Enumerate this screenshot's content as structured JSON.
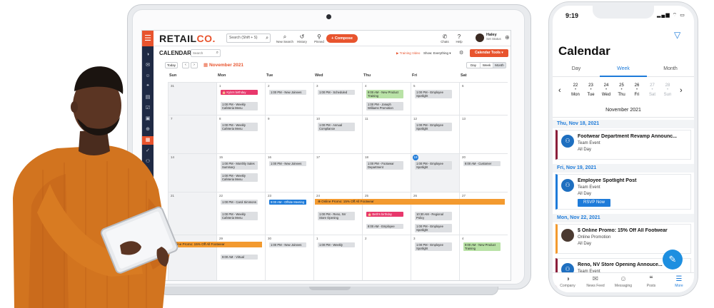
{
  "app": {
    "logo_main": "RETAIL",
    "logo_accent": "CO.",
    "search_placeholder": "Search (Shift + S)",
    "toolbar": [
      {
        "id": "new-search",
        "label": "New Search",
        "icon": "new-search-icon",
        "glyph": "⌕"
      },
      {
        "id": "history",
        "label": "History",
        "icon": "history-icon",
        "glyph": "↺"
      },
      {
        "id": "pinned",
        "label": "Pinned",
        "icon": "pin-icon",
        "glyph": "⚲"
      }
    ],
    "compose_label": "+ Compose",
    "chats_label": "Chats",
    "help_label": "Help",
    "user_name": "Haley",
    "user_status": "Set Status"
  },
  "sidebar_icons": [
    "company-icon",
    "news-feed-icon",
    "messaging-icon",
    "posts-icon",
    "folder-icon",
    "tasks-icon",
    "gallery-icon",
    "globe-icon",
    "calendar-icon",
    "check-icon",
    "people-icon",
    "edit-icon",
    "gift-icon",
    "settings-icon"
  ],
  "calendar": {
    "title": "CALENDAR",
    "search_placeholder": "Search",
    "training_label": "Training Video",
    "show_label": "Show: Everything ▾",
    "tools_label": "Calendar Tools ▾",
    "today_label": "Today",
    "prev": "‹",
    "next": "›",
    "month_label": "November 2021",
    "views": [
      "Day",
      "Week",
      "Month"
    ],
    "active_view": "Month",
    "days_of_week": [
      "Sun",
      "Mon",
      "Tue",
      "Wed",
      "Thu",
      "Fri",
      "Sat"
    ],
    "weeks": [
      [
        "31",
        "1",
        "2",
        "3",
        "4",
        "5",
        "6"
      ],
      [
        "7",
        "8",
        "9",
        "10",
        "11",
        "12",
        "13"
      ],
      [
        "14",
        "15",
        "16",
        "17",
        "18",
        "19",
        "20"
      ],
      [
        "21",
        "22",
        "23",
        "24",
        "25",
        "26",
        "27"
      ],
      [
        "28",
        "29",
        "30",
        "1",
        "2",
        "3",
        "4"
      ]
    ],
    "today_date": "19",
    "events": [
      {
        "week": 0,
        "day": 1,
        "slot": 0,
        "style": "pink",
        "text": "🎂 Kyla's birthday"
      },
      {
        "week": 0,
        "day": 1,
        "slot": 1,
        "style": "gray",
        "text": "1:00 PM - Weekly Cafeteria Menu"
      },
      {
        "week": 0,
        "day": 2,
        "slot": 0,
        "style": "gray",
        "text": "1:00 PM - New Joinees"
      },
      {
        "week": 0,
        "day": 3,
        "slot": 0,
        "style": "gray",
        "text": "1:00 PM - Scheduled"
      },
      {
        "week": 0,
        "day": 4,
        "slot": 0,
        "style": "green",
        "text": "9:00 AM - New Product Training"
      },
      {
        "week": 0,
        "day": 4,
        "slot": 1,
        "style": "gray",
        "text": "1:00 PM - Joseph Williams Promotion"
      },
      {
        "week": 0,
        "day": 5,
        "slot": 0,
        "style": "gray",
        "text": "1:00 PM - Employee Spotlight"
      },
      {
        "week": 1,
        "day": 1,
        "slot": 0,
        "style": "gray",
        "text": "1:00 PM - Weekly Cafeteria Menu"
      },
      {
        "week": 1,
        "day": 3,
        "slot": 0,
        "style": "gray",
        "text": "1:00 PM - Annual Compliance"
      },
      {
        "week": 1,
        "day": 5,
        "slot": 0,
        "style": "gray",
        "text": "1:00 PM - Employee Spotlight"
      },
      {
        "week": 2,
        "day": 1,
        "slot": 0,
        "style": "gray",
        "text": "1:00 PM - Monthly Sales Summary"
      },
      {
        "week": 2,
        "day": 1,
        "slot": 1,
        "style": "gray",
        "text": "1:00 PM - Weekly Cafeteria Menu"
      },
      {
        "week": 2,
        "day": 2,
        "slot": 0,
        "style": "gray",
        "text": "1:00 PM - New Joinees"
      },
      {
        "week": 2,
        "day": 4,
        "slot": 0,
        "style": "gray",
        "text": "1:00 PM - Footwear Department"
      },
      {
        "week": 2,
        "day": 5,
        "slot": 0,
        "style": "gray",
        "text": "1:00 PM - Employee Spotlight"
      },
      {
        "week": 2,
        "day": 6,
        "slot": 0,
        "style": "gray",
        "text": "8:00 AM - Customer"
      },
      {
        "week": 3,
        "day": 1,
        "slot": 0,
        "style": "gray",
        "text": "1:00 PM - Carol Simmons"
      },
      {
        "week": 3,
        "day": 1,
        "slot": 1,
        "style": "gray",
        "text": "1:00 PM - Weekly Cafeteria Menu"
      },
      {
        "week": 3,
        "day": 2,
        "slot": 0,
        "style": "blue",
        "text": "9:00 AM - Offsite Meeting"
      },
      {
        "week": 3,
        "day": 3,
        "slot": 1,
        "style": "gray",
        "text": "1:00 PM - Reno, NV Store Opening"
      },
      {
        "week": 3,
        "day": 4,
        "slot": 1,
        "style": "pink",
        "text": "🎂 Beth's birthday"
      },
      {
        "week": 3,
        "day": 4,
        "slot": 2,
        "style": "gray",
        "text": "8:00 AM - Employee"
      },
      {
        "week": 3,
        "day": 5,
        "slot": 1,
        "style": "gray",
        "text": "10:30 AM - Regional Policy"
      },
      {
        "week": 3,
        "day": 5,
        "slot": 2,
        "style": "gray",
        "text": "1:00 PM - Employee Spotlight"
      },
      {
        "week": 4,
        "day": 1,
        "slot": 1,
        "style": "gray",
        "text": "9:00 AM - Virtual"
      },
      {
        "week": 4,
        "day": 2,
        "slot": 0,
        "style": "gray",
        "text": "1:00 PM - New Joinees"
      },
      {
        "week": 4,
        "day": 3,
        "slot": 0,
        "style": "gray",
        "text": "1:00 PM - Weekly"
      },
      {
        "week": 4,
        "day": 5,
        "slot": 0,
        "style": "gray",
        "text": "1:00 PM - Employee Spotlight"
      },
      {
        "week": 4,
        "day": 6,
        "slot": 0,
        "style": "green",
        "text": "9:00 AM - New Product Training"
      }
    ],
    "banners": [
      {
        "week": 3,
        "from": 3,
        "to": 6,
        "text": "⊕ Online Promo: 15% Off All Footwear"
      },
      {
        "week": 4,
        "from": 0,
        "to": 1,
        "text": "Online Promo: 15% Off All Footwear"
      }
    ]
  },
  "phone": {
    "time": "9:19",
    "status_icons": "▂▄▆ ⌔ ▭",
    "title": "Calendar",
    "tabs": [
      "Day",
      "Week",
      "Month"
    ],
    "active_tab": "Week",
    "week_days": [
      {
        "num": "22",
        "day": "Mon",
        "dim": false
      },
      {
        "num": "23",
        "day": "Tue",
        "dim": false
      },
      {
        "num": "24",
        "day": "Wed",
        "dim": false
      },
      {
        "num": "25",
        "day": "Thu",
        "dim": false
      },
      {
        "num": "26",
        "day": "Fri",
        "dim": false
      },
      {
        "num": "27",
        "day": "Sat",
        "dim": true
      },
      {
        "num": "28",
        "day": "Sun",
        "dim": true
      }
    ],
    "prev": "‹",
    "next": "›",
    "month": "November 2021",
    "groups": [
      {
        "date": "Thu, Nov 18, 2021",
        "title": "Footwear Department Revamp Announc...",
        "type": "Team Event",
        "when": "All Day",
        "style": "maroon",
        "avatar": "team"
      },
      {
        "date": "Fri, Nov 19, 2021",
        "title": "Employee Spotlight Post",
        "type": "Team Event",
        "when": "All Day",
        "style": "blue",
        "avatar": "team",
        "rsvp": "RSVP Now"
      },
      {
        "date": "Mon, Nov 22, 2021",
        "title": "$ Online Promo: 15% Off All Footwear",
        "type": "Online Promotion",
        "when": "All Day",
        "style": "orange",
        "avatar": "photo"
      },
      {
        "date": "",
        "title": "Reno, NV Store Opening Annouce...",
        "type": "Team Event",
        "when": "All Day",
        "style": "maroon",
        "avatar": "team"
      }
    ],
    "nav": [
      {
        "label": "Company",
        "glyph": "◑",
        "icon": "company-icon"
      },
      {
        "label": "News Feed",
        "glyph": "✉",
        "icon": "news-feed-icon"
      },
      {
        "label": "Messaging",
        "glyph": "☺",
        "icon": "messaging-icon"
      },
      {
        "label": "Posts",
        "glyph": "❝",
        "icon": "posts-icon"
      },
      {
        "label": "More",
        "glyph": "☰",
        "icon": "more-icon",
        "active": true
      }
    ]
  },
  "colors": {
    "accent": "#e8542e",
    "sidebar": "#1f2a44",
    "blue": "#1e7bd9",
    "promo": "#f39a2f",
    "birthday": "#e8386c",
    "training": "#b9e2a6"
  }
}
